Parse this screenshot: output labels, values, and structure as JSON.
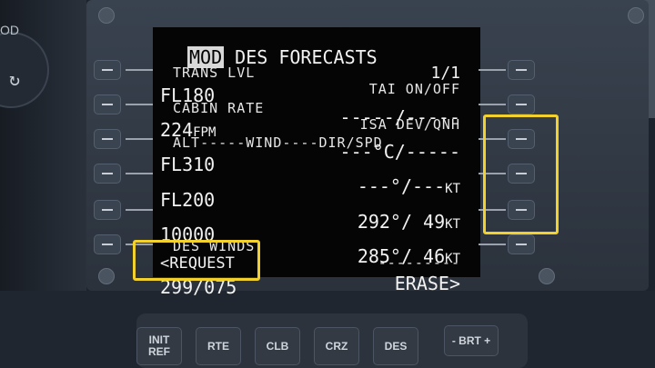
{
  "cockpit": {
    "left_knob_label": "OD"
  },
  "cdu": {
    "title_mod": "MOD",
    "title": "DES FORECASTS",
    "page": "1/1",
    "rows": [
      {
        "label_left": "TRANS LVL",
        "label_right": "TAI ON/OFF",
        "value_left": "FL180",
        "value_left_unit": "",
        "value_right": "-----/-----",
        "value_right_unit": ""
      },
      {
        "label_left": "CABIN RATE",
        "label_right": "ISA DEV/QNH",
        "value_left": "224",
        "value_left_unit": "FPM",
        "value_right": "---°C/-----",
        "value_right_unit": ""
      },
      {
        "label_left": "ALT-----WIND----DIR/SPD",
        "label_right": "",
        "value_left": "FL310",
        "value_left_unit": "",
        "value_right": "---°/---",
        "value_right_unit": "KT"
      },
      {
        "label_left": "",
        "label_right": "",
        "value_left": "FL200",
        "value_left_unit": "",
        "value_right": "292°/ 49",
        "value_right_unit": "KT"
      },
      {
        "label_left": "",
        "label_right": "",
        "value_left": "10000",
        "value_left_unit": "",
        "value_right": "285°/ 46",
        "value_right_unit": "KT"
      },
      {
        "label_left": "DES WINDS",
        "label_right": "---------",
        "value_left": "<REQUEST",
        "value_left_unit": "",
        "value_right": "ERASE>",
        "value_right_unit": ""
      }
    ],
    "scratchpad": "299/075"
  },
  "keys": {
    "init_ref": "INIT\nREF",
    "rte": "RTE",
    "clb": "CLB",
    "crz": "CRZ",
    "des": "DES",
    "brt": "- BRT +"
  },
  "colors": {
    "highlight": "#f2d12c",
    "screen_text": "#f2f2f2",
    "mod_inverse": "#d9d9d9"
  }
}
